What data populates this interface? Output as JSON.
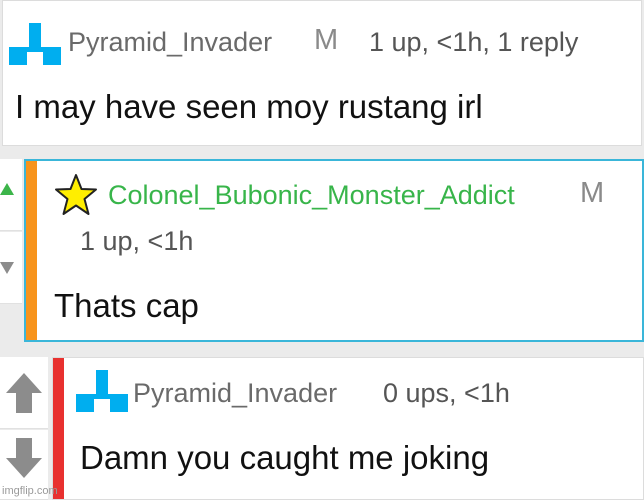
{
  "comments": [
    {
      "username": "Pyramid_Invader",
      "mod_badge": "M",
      "meta": "1 up, <1h, 1 reply",
      "text": "I may have seen moy rustang irl",
      "avatar_icon": "pyramid-invader-icon"
    },
    {
      "username": "Colonel_Bubonic_Monster_Addict",
      "mod_badge": "M",
      "meta": "1 up, <1h",
      "text": "Thats cap",
      "avatar_icon": "star-icon",
      "highlight_color": "#3ab6d9",
      "strip_color": "#f7941d"
    },
    {
      "username": "Pyramid_Invader",
      "meta": "0 ups, <1h",
      "text": "Damn you caught me joking",
      "avatar_icon": "pyramid-invader-icon",
      "strip_color": "#e8312f"
    }
  ],
  "watermark": "imgflip.com",
  "colors": {
    "username_green": "#38b54a",
    "invader_blue": "#00aeef",
    "upvote_active": "#3cb54a",
    "vote_gray": "#8c8c8c"
  }
}
